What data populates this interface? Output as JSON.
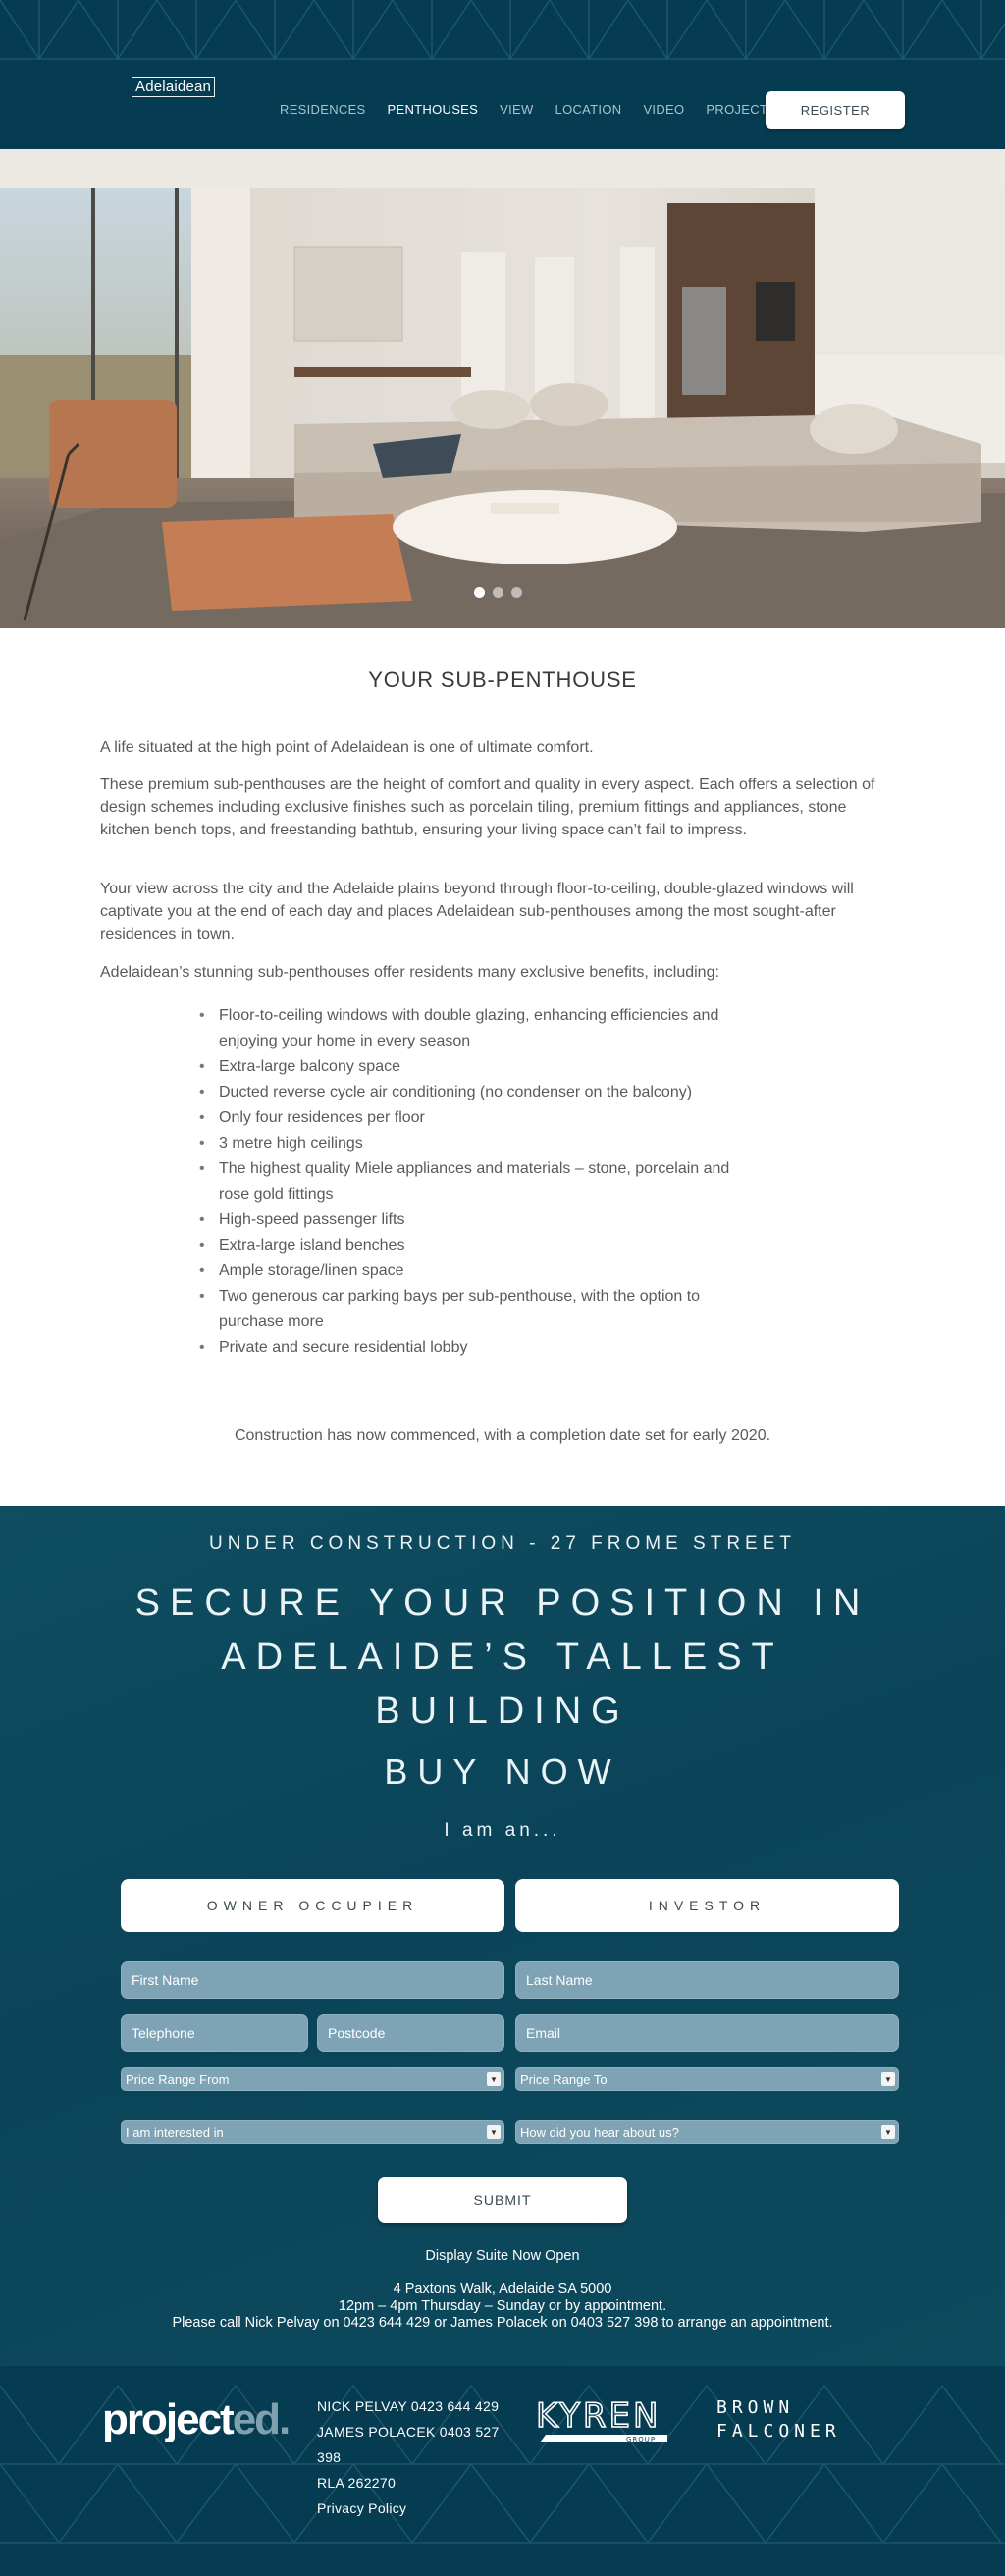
{
  "header": {
    "logo": "Adelaidean",
    "nav": [
      "RESIDENCES",
      "PENTHOUSES",
      "VIEW",
      "LOCATION",
      "VIDEO",
      "PROJECT"
    ],
    "active_nav": "PENTHOUSES",
    "register_label": "REGISTER"
  },
  "hero": {
    "slides": 3,
    "active_slide": 1
  },
  "content": {
    "title": "YOUR SUB-PENTHOUSE",
    "paragraphs": [
      "A life situated at the high point of Adelaidean is one of ultimate comfort.",
      "These premium sub-penthouses are the height of comfort and quality in every aspect. Each offers a selection of design schemes including exclusive finishes such as porcelain tiling, premium fittings and appliances, stone kitchen bench tops, and freestanding bathtub, ensuring your living space can’t fail to impress.",
      "Your view across the city and the Adelaide plains beyond through floor-to-ceiling, double-glazed windows will captivate you at the end of each day and places Adelaidean sub-penthouses among the most sought-after residences in town.",
      "Adelaidean’s stunning sub-penthouses offer residents many exclusive benefits, including:"
    ],
    "benefits": [
      "Floor-to-ceiling windows with double glazing, enhancing efficiencies and enjoying your home in every season",
      "Extra-large balcony space",
      "Ducted reverse cycle air conditioning (no condenser on the balcony)",
      "Only four residences per floor",
      "3 metre high ceilings",
      "The highest quality Miele appliances and materials – stone, porcelain and rose gold fittings",
      "High-speed passenger lifts",
      "Extra-large island benches",
      "Ample storage/linen space",
      "Two generous car parking bays per sub-penthouse, with the option to purchase more",
      "Private and secure residential lobby"
    ],
    "construction_note": "Construction has now commenced, with a completion date set for early 2020."
  },
  "buy": {
    "under_construction": "UNDER CONSTRUCTION -  27 FROME STREET",
    "headline": "SECURE YOUR POSITION IN ADELAIDE’S TALLEST BUILDING",
    "buy_now": "BUY NOW",
    "i_am": "I am an...",
    "choices": [
      "OWNER OCCUPIER",
      "INVESTOR"
    ],
    "fields": {
      "first_name": "First Name",
      "last_name": "Last Name",
      "telephone": "Telephone",
      "postcode": "Postcode",
      "email": "Email"
    },
    "selects": {
      "price_from": "Price Range From",
      "price_to": "Price Range To",
      "interested": "I am interested in",
      "heard": "How did you hear about us?"
    },
    "submit_label": "SUBMIT",
    "display_suite": "Display Suite Now Open",
    "address": "4 Paxtons Walk, Adelaide SA 5000",
    "hours": "12pm – 4pm Thursday – Sunday or by appointment.",
    "call": "Please call Nick Pelvay on 0423 644 429 or James Polacek on 0403 527 398 to arrange an appointment."
  },
  "footer": {
    "brand_main": "project",
    "brand_suffix": "ed.",
    "contact_lines": [
      "NICK PELVAY   0423 644 429",
      "JAMES POLACEK   0403 527 398",
      "RLA 262270",
      "Privacy Policy"
    ],
    "kyren": "KYREN",
    "kyren_sub": "GROUP",
    "brown_falconer": [
      "BROWN",
      "FALCONER"
    ]
  },
  "colors": {
    "navy": "#063c52",
    "teal": "#0d4a5d",
    "field": "#7ea3b4"
  }
}
